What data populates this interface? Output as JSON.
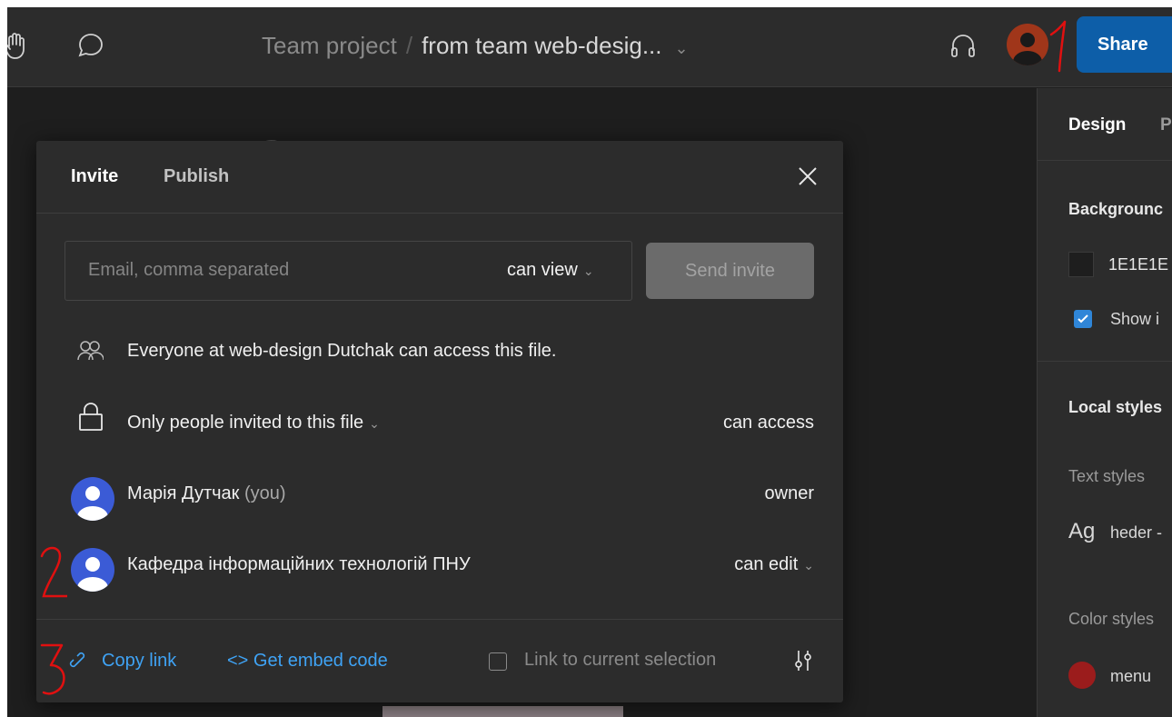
{
  "topbar": {
    "project": "Team project",
    "separator": "/",
    "file_name": "from team web-desig...",
    "share_label": "Share",
    "icons": [
      "hand-icon",
      "comment-icon",
      "headphones-icon",
      "avatar"
    ]
  },
  "right_panel": {
    "tab_design": "Design",
    "tab_prototype": "P",
    "background_heading": "Backgrounc",
    "background_value": "1E1E1E",
    "show_label": "Show i",
    "local_styles": "Local styles",
    "text_styles": "Text styles",
    "text_style_sample": "Ag",
    "text_style_name": "heder -",
    "color_styles": "Color styles",
    "color_style_name": "menu"
  },
  "dialog": {
    "tab_invite": "Invite",
    "tab_publish": "Publish",
    "email_placeholder": "Email, comma separated",
    "permission": "can view",
    "send_label": "Send invite",
    "everyone_text": "Everyone at web-design Dutchak can access this file.",
    "access_scope": "Only people invited to this file",
    "access_level": "can access",
    "members": [
      {
        "name": "Марія Дутчак",
        "suffix": "(you)",
        "role": "owner"
      },
      {
        "name": "Кафедра інформаційних технологій ПНУ",
        "suffix": "",
        "role": "can edit"
      }
    ],
    "copy_link": "Copy link",
    "embed_code": "Get embed code",
    "link_selection": "Link to current selection"
  },
  "annotations": [
    "1",
    "2",
    "3"
  ],
  "colors": {
    "accent": "#0d5ea8",
    "link": "#3fa3f5",
    "dialog_bg": "#2c2c2c",
    "canvas_bg": "#1e1e1e",
    "annotation": "#e01010"
  }
}
